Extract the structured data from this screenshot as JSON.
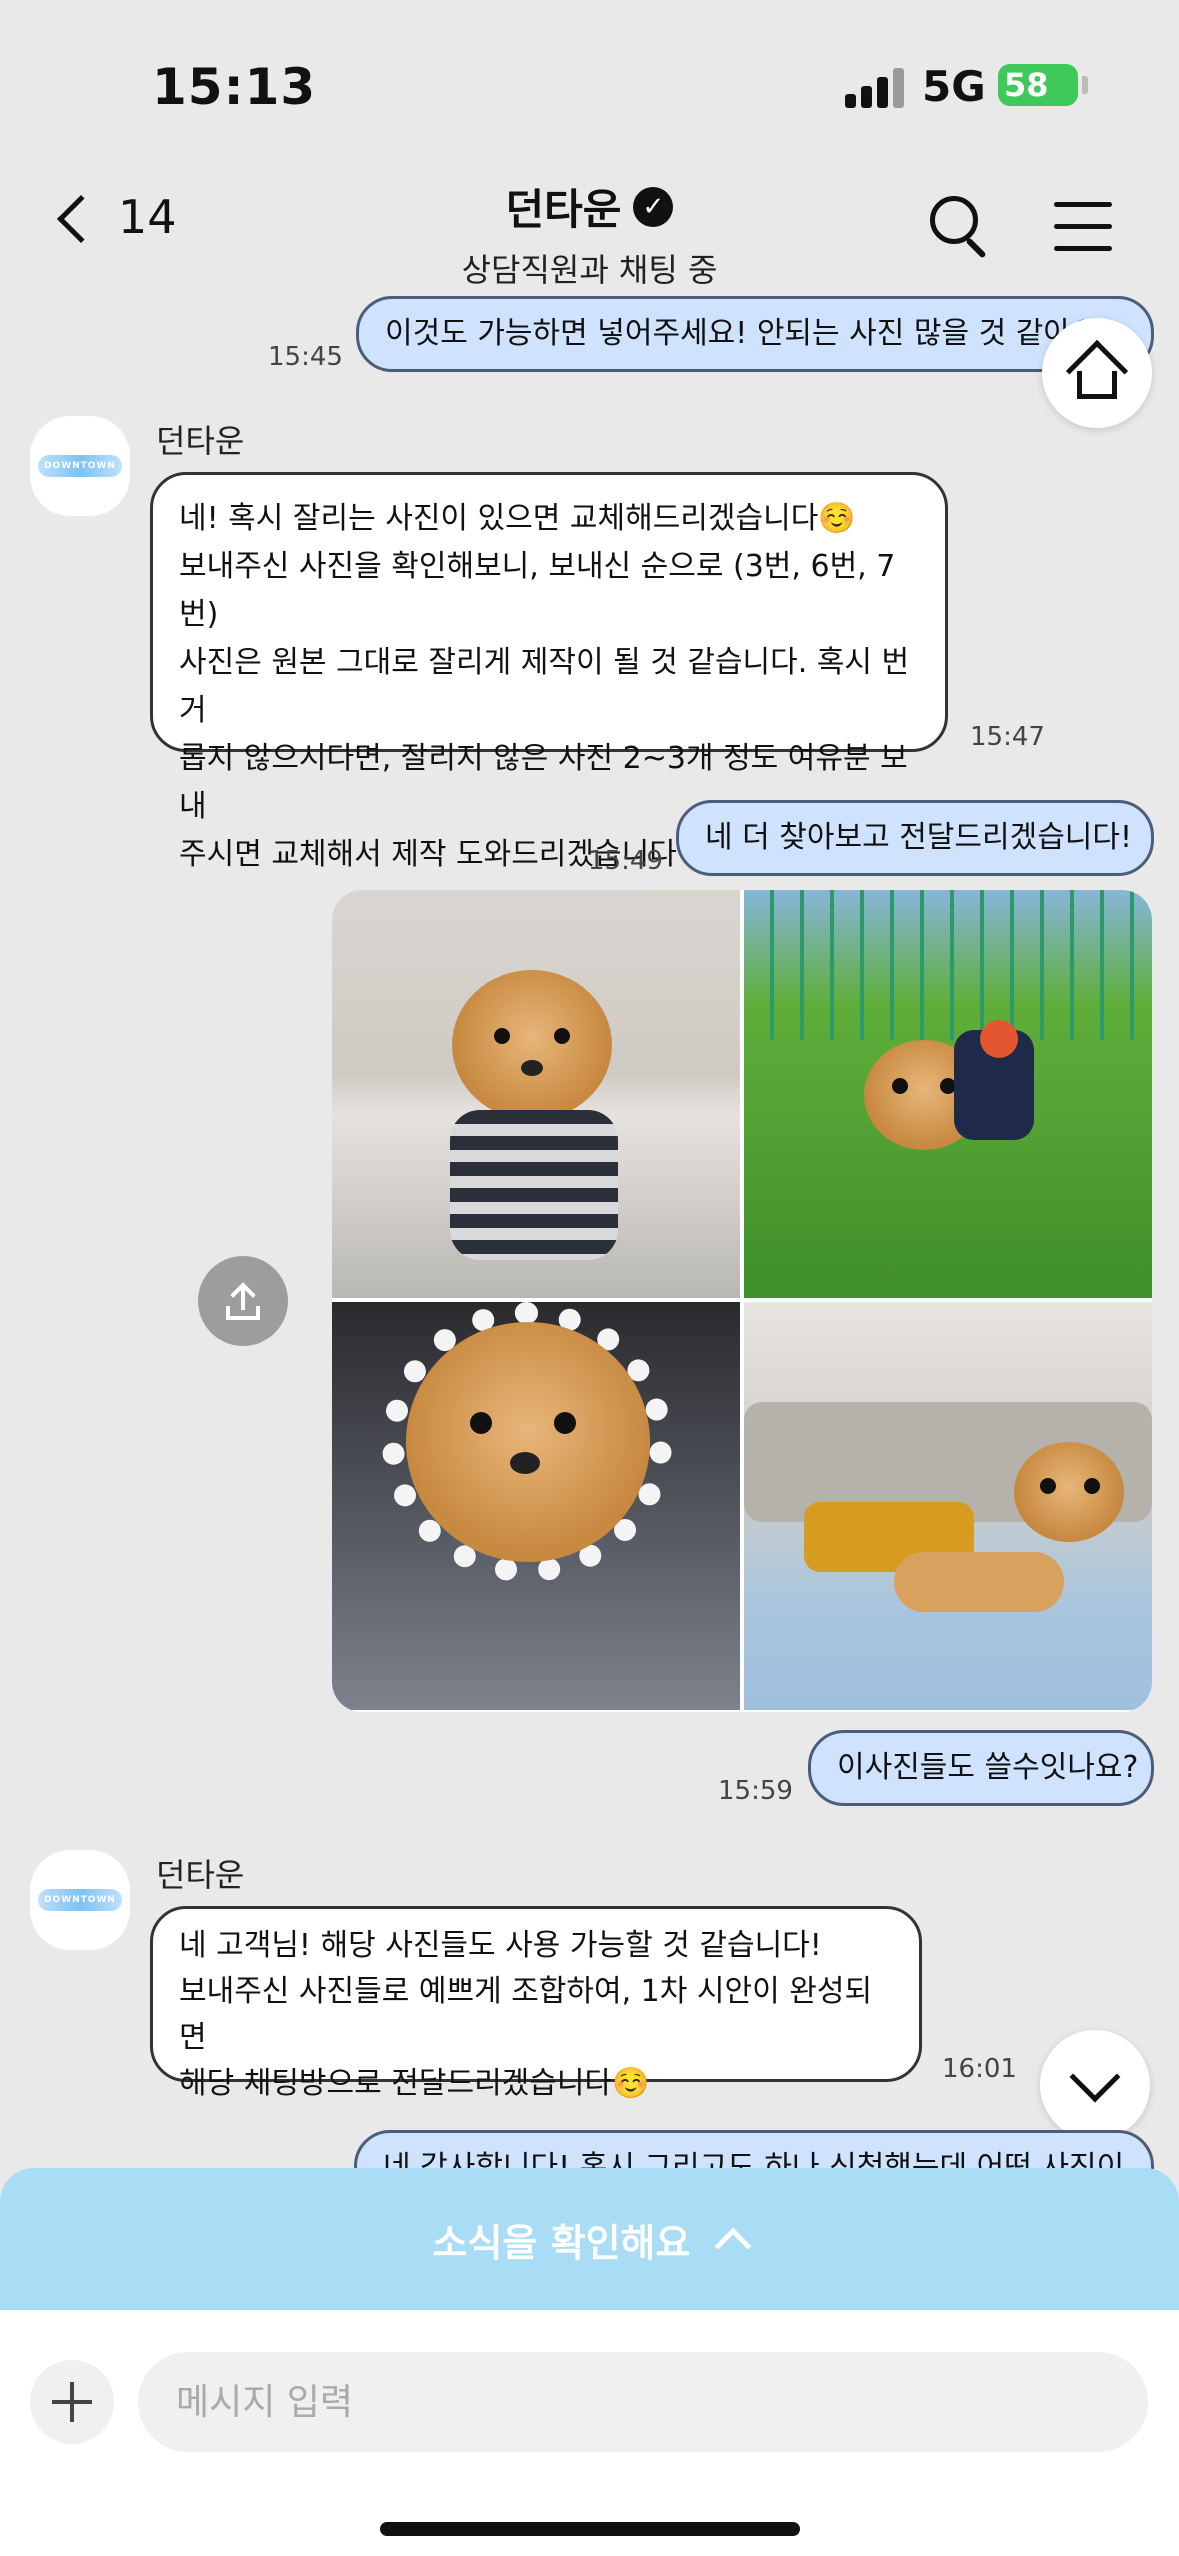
{
  "status": {
    "time": "15:13",
    "network": "5G",
    "battery": "58"
  },
  "header": {
    "back_count": "14",
    "title": "던타운",
    "verified_mark": "✓",
    "subtitle": "상담직원과 채팅 중"
  },
  "avatar_logo_text": "DOWNTOWN",
  "messages": [
    {
      "text": "이것도 가능하면 넣어주세요! 안되는 사진 많을 것 같아요",
      "time": "15:45"
    },
    {
      "sender": "던타운",
      "lines": [
        "네! 혹시 잘리는 사진이 있으면 교체해드리겠습니다☺️",
        "보내주신 사진을 확인해보니, 보내신 순으로 (3번, 6번, 7번)",
        "사진은 원본 그대로 잘리게 제작이 될 것 같습니다. 혹시 번거",
        "롭지 않으시다면, 잘리지 않은 사진 2~3개 정도 여유분 보내",
        "주시면 교체해서 제작 도와드리겠습니다🤍"
      ],
      "time": "15:47"
    },
    {
      "text": "네 더 찾아보고 전달드리겠습니다!",
      "time": "15:49"
    },
    {
      "text": "이사진들도 쓸수잇나요?",
      "time": "15:59"
    },
    {
      "sender": "던타운",
      "lines": [
        "네 고객님! 해당 사진들도 사용 가능할 것 같습니다!",
        "보내주신 사진들로 예쁘게 조합하여, 1차 시안이 완성되면",
        "해당 채팅방으로 전달드리겠습니다☺️"
      ],
      "time": "16:01"
    },
    {
      "text": "네 감사합니다! 혹시 그리고도 하나 신청했는데 어떤 사진이"
    }
  ],
  "banner": {
    "label": "소식을 확인해요"
  },
  "input": {
    "placeholder": "메시지 입력"
  },
  "colors": {
    "outgoing_bubble": "#cfe3ff",
    "banner": "#a9dcf5",
    "battery": "#3ec95a"
  }
}
